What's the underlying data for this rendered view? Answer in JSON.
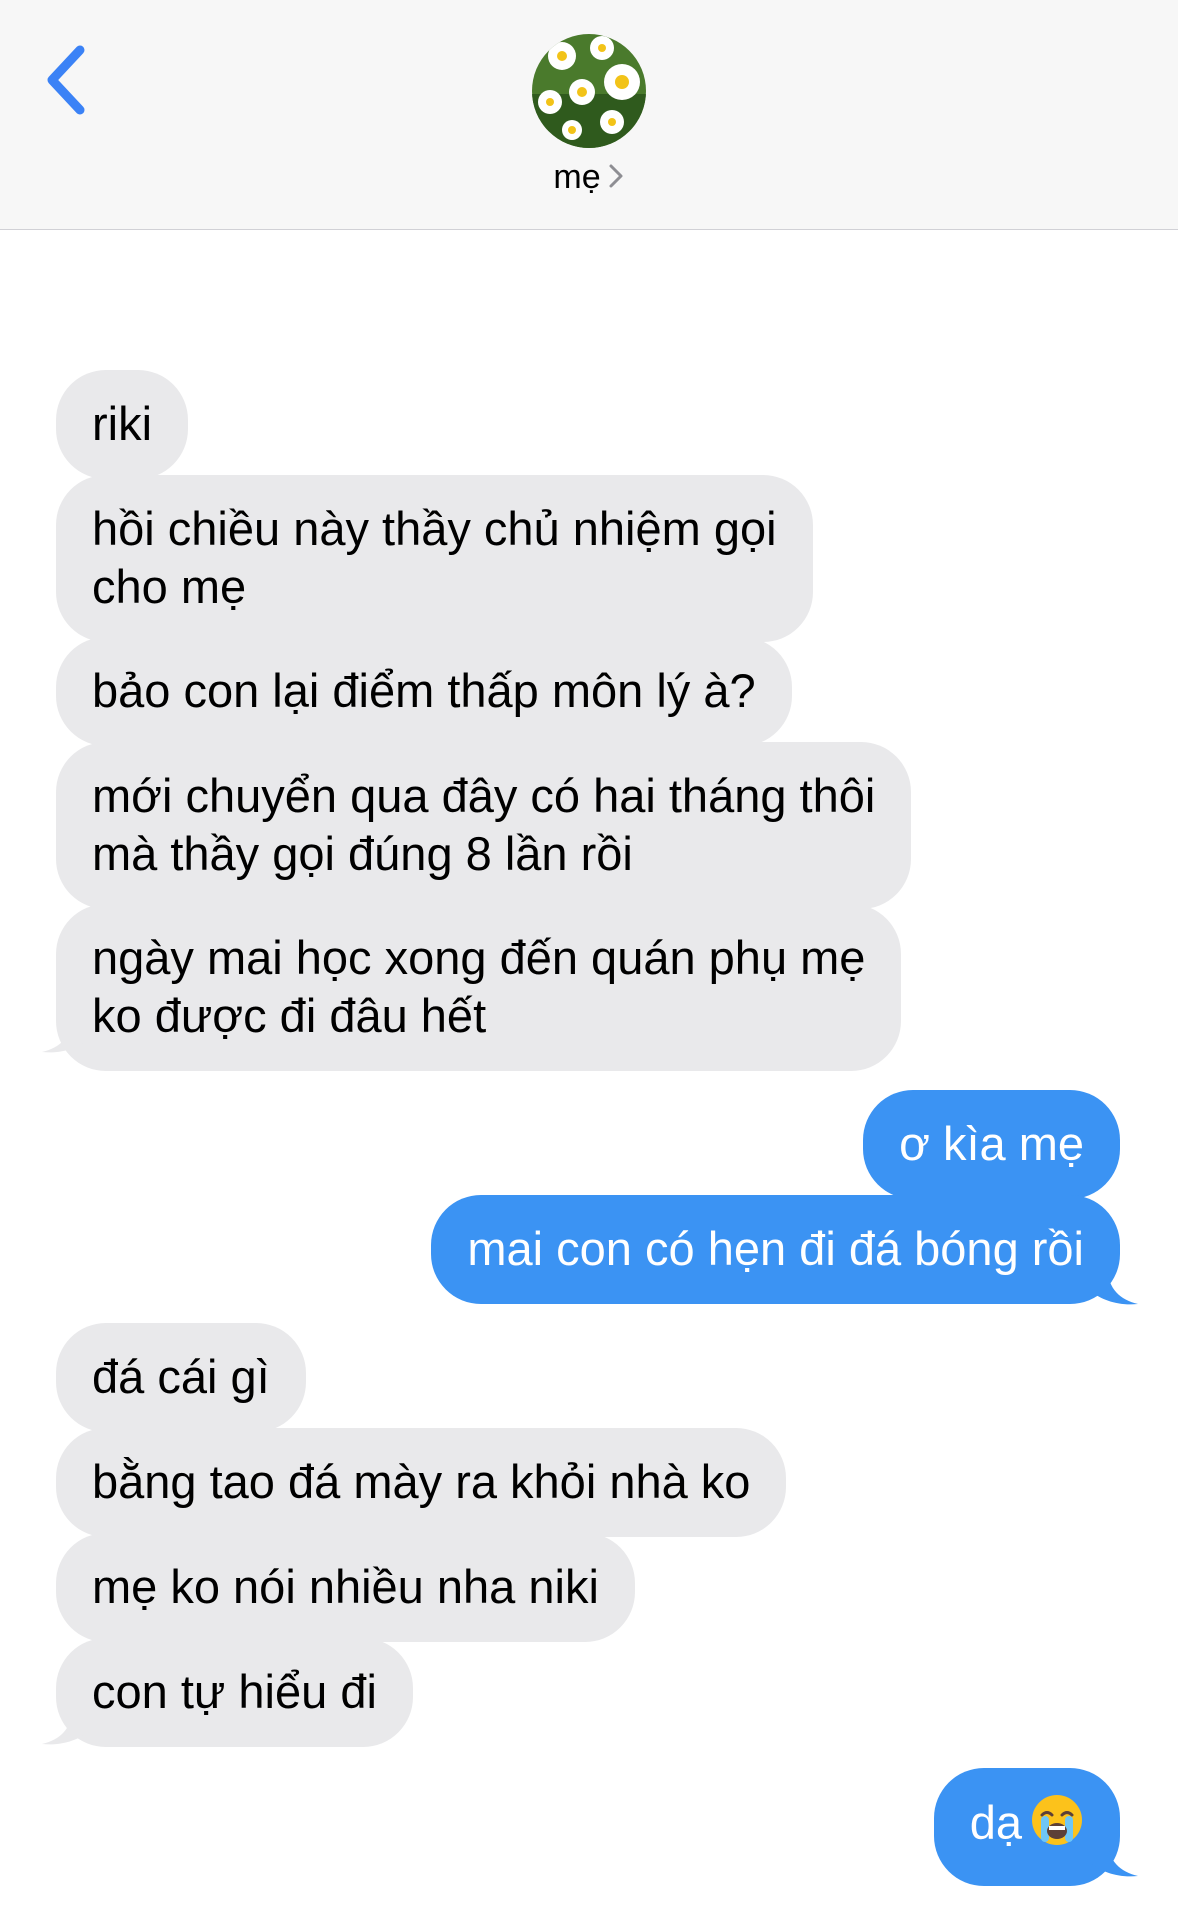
{
  "header": {
    "back_icon": "chevron-left-icon",
    "contact_name": "mẹ",
    "avatar": "daisy-flowers-photo",
    "accent": "#3b82f6"
  },
  "messages": [
    {
      "direction": "incoming",
      "text": "riki"
    },
    {
      "direction": "incoming",
      "text": "hồi chiều này thầy chủ nhiệm gọi",
      "text2": "cho mẹ"
    },
    {
      "direction": "incoming",
      "text": "bảo con lại điểm thấp môn lý à?"
    },
    {
      "direction": "incoming",
      "text": "mới chuyển qua đây có hai tháng thôi",
      "text2": "mà thầy gọi đúng 8 lần rồi"
    },
    {
      "direction": "incoming",
      "text": "ngày mai học xong đến quán phụ mẹ",
      "text2": "ko được đi đâu hết"
    },
    {
      "direction": "outgoing",
      "text": "ơ kìa mẹ"
    },
    {
      "direction": "outgoing",
      "text": "mai con có hẹn đi đá bóng rồi"
    },
    {
      "direction": "incoming",
      "text": "đá cái gì"
    },
    {
      "direction": "incoming",
      "text": "bằng tao đá mày ra khỏi nhà ko"
    },
    {
      "direction": "incoming",
      "text": "mẹ ko nói nhiều nha niki"
    },
    {
      "direction": "incoming",
      "text": "con tự hiểu đi"
    },
    {
      "direction": "outgoing",
      "text": "dạ",
      "emoji": "crying-face-emoji"
    }
  ],
  "colors": {
    "incoming_bubble": "#e9e9eb",
    "outgoing_bubble": "#3b93f3",
    "header_bg": "#f7f7f7"
  }
}
